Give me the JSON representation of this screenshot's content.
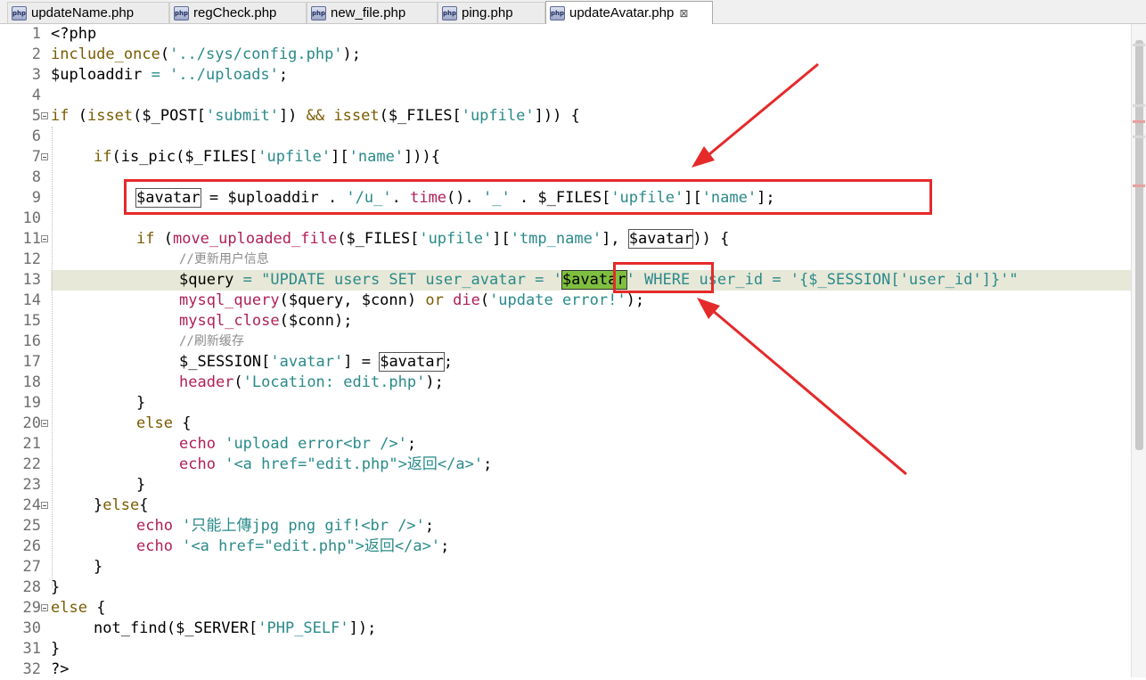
{
  "tabs": [
    {
      "label": "updateName.php",
      "active": false
    },
    {
      "label": "regCheck.php",
      "active": false
    },
    {
      "label": "new_file.php",
      "active": false
    },
    {
      "label": "ping.php",
      "active": false
    },
    {
      "label": "updateAvatar.php",
      "active": true
    }
  ],
  "tab_icon_text": "php",
  "close_glyph": "⊠",
  "line_numbers": [
    "1",
    "2",
    "3",
    "4",
    "5",
    "6",
    "7",
    "8",
    "9",
    "10",
    "11",
    "12",
    "13",
    "14",
    "15",
    "16",
    "17",
    "18",
    "19",
    "20",
    "21",
    "22",
    "23",
    "24",
    "25",
    "26",
    "27",
    "28",
    "29",
    "30",
    "31",
    "32"
  ],
  "fold_lines": [
    5,
    7,
    11,
    20,
    24,
    29
  ],
  "code": {
    "l1": "<?php",
    "l2a": "include_once",
    "l2b": "(",
    "l2c": "'../sys/config.php'",
    "l2d": ");",
    "l3a": "$uploaddir",
    "l3b": " = ",
    "l3c": "'../uploads'",
    "l3d": ";",
    "l5a": "if",
    "l5b": " (",
    "l5c": "isset",
    "l5d": "($_POST[",
    "l5e": "'submit'",
    "l5f": "]) ",
    "l5g": "&&",
    "l5h": " ",
    "l5i": "isset",
    "l5j": "($_FILES[",
    "l5k": "'upfile'",
    "l5l": "])) {",
    "l7a": "if",
    "l7b": "(is_pic($_FILES[",
    "l7c": "'upfile'",
    "l7d": "][",
    "l7e": "'name'",
    "l7f": "])){",
    "l9a": "$avatar",
    "l9b": " = $uploaddir . ",
    "l9c": "'/u_'",
    "l9d": ". ",
    "l9e": "time",
    "l9f": "(). ",
    "l9g": "'_'",
    "l9h": " . $_FILES[",
    "l9i": "'upfile'",
    "l9j": "][",
    "l9k": "'name'",
    "l9l": "];",
    "l11a": "if",
    "l11b": " (",
    "l11c": "move_uploaded_file",
    "l11d": "($_FILES[",
    "l11e": "'upfile'",
    "l11f": "][",
    "l11g": "'tmp_name'",
    "l11h": "], ",
    "l11i": "$avatar",
    "l11j": ")) {",
    "l12": "//更新用户信息",
    "l13a": "$query",
    "l13b": " = ",
    "l13c": "\"UPDATE users SET user_avatar = '",
    "l13d": "$avatar",
    "l13e": "' WHERE user_id = '{$_SESSION['user_id']}'\"",
    "l14a": "mysql_query",
    "l14b": "($query, $conn) ",
    "l14c": "or",
    "l14d": " ",
    "l14e": "die",
    "l14f": "(",
    "l14g": "'update error!'",
    "l14h": ");",
    "l15a": "mysql_close",
    "l15b": "($conn);",
    "l16": "//刷新缓存",
    "l17a": "$_SESSION[",
    "l17b": "'avatar'",
    "l17c": "] = ",
    "l17d": "$avatar",
    "l17e": ";",
    "l18a": "header",
    "l18b": "(",
    "l18c": "'Location: edit.php'",
    "l18d": ");",
    "l19": "}",
    "l20a": "else",
    "l20b": " {",
    "l21a": "echo",
    "l21b": " ",
    "l21c": "'upload error<br />'",
    "l21d": ";",
    "l22a": "echo",
    "l22b": " ",
    "l22c": "'<a href=\"edit.php\">返回</a>'",
    "l22d": ";",
    "l23": "}",
    "l24a": "}",
    "l24b": "else",
    "l24c": "{",
    "l25a": "echo",
    "l25b": " ",
    "l25c": "'只能上傳jpg png gif!<br />'",
    "l25d": ";",
    "l26a": "echo",
    "l26b": " ",
    "l26c": "'<a href=\"edit.php\">返回</a>'",
    "l26d": ";",
    "l27": "}",
    "l28": "}",
    "l29a": "else",
    "l29b": " {",
    "l30a": "not_find",
    "l30b": "($_SERVER[",
    "l30c": "'PHP_SELF'",
    "l30d": "]);",
    "l31": "}",
    "l32": "?>"
  },
  "colors": {
    "annotation": "#e52a2a",
    "keyword": "#7a5c00",
    "function": "#b01f57",
    "string": "#2a8a8a",
    "occurrence": "#7fbf3f"
  }
}
